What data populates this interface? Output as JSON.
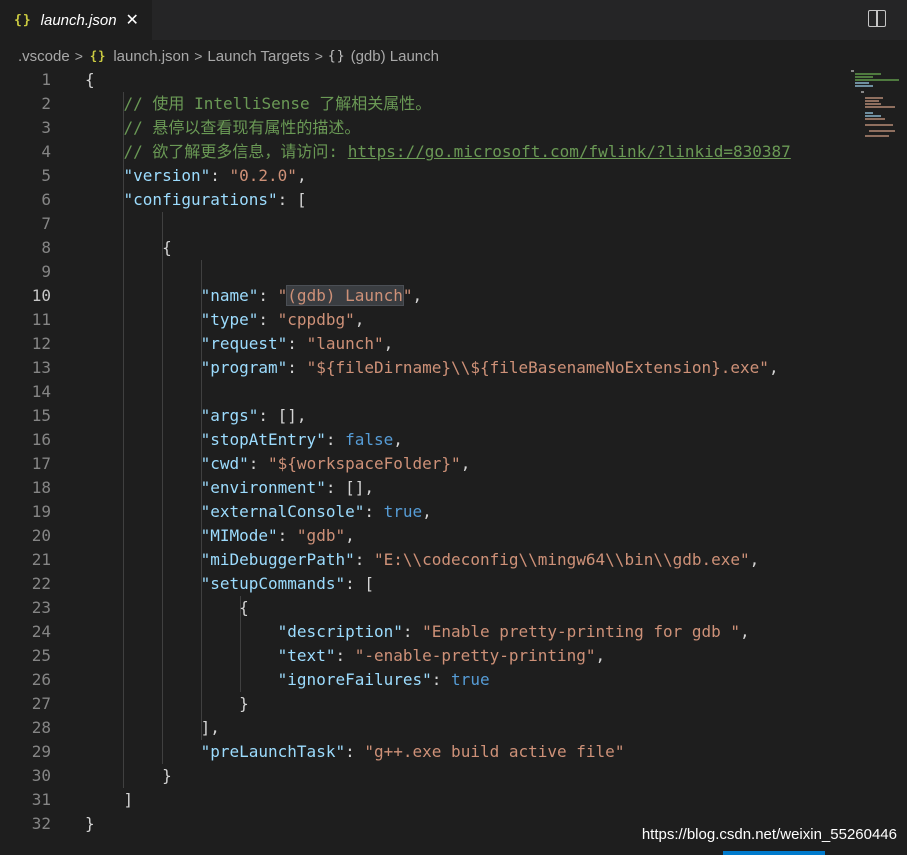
{
  "tab": {
    "icon": "{}",
    "label": "launch.json",
    "close": "✕"
  },
  "breadcrumb": {
    "folder": ".vscode",
    "file": "launch.json",
    "section": "Launch Targets",
    "item": "(gdb) Launch",
    "file_icon": "{}",
    "item_icon": "{}"
  },
  "editor": {
    "active_line": 10,
    "lines": [
      {
        "n": "1",
        "t": [
          [
            "pun",
            "{"
          ]
        ]
      },
      {
        "n": "2",
        "t": [
          [
            "com",
            "    // 使用 IntelliSense 了解相关属性。"
          ]
        ]
      },
      {
        "n": "3",
        "t": [
          [
            "com",
            "    // 悬停以查看现有属性的描述。"
          ]
        ]
      },
      {
        "n": "4",
        "t": [
          [
            "com",
            "    // 欲了解更多信息，请访问: "
          ],
          [
            "link",
            "https://go.microsoft.com/fwlink/?linkid=830387"
          ]
        ]
      },
      {
        "n": "5",
        "t": [
          [
            "pun",
            "    "
          ],
          [
            "key",
            "\"version\""
          ],
          [
            "pun",
            ": "
          ],
          [
            "str",
            "\"0.2.0\""
          ],
          [
            "pun",
            ","
          ]
        ]
      },
      {
        "n": "6",
        "t": [
          [
            "pun",
            "    "
          ],
          [
            "key",
            "\"configurations\""
          ],
          [
            "pun",
            ": ["
          ]
        ]
      },
      {
        "n": "7",
        "t": []
      },
      {
        "n": "8",
        "t": [
          [
            "pun",
            "        {"
          ]
        ]
      },
      {
        "n": "9",
        "t": []
      },
      {
        "n": "10",
        "t": [
          [
            "pun",
            "            "
          ],
          [
            "key",
            "\"name\""
          ],
          [
            "pun",
            ": "
          ],
          [
            "str",
            "\""
          ],
          [
            "strhl",
            "(gdb) Launch"
          ],
          [
            "str",
            "\""
          ],
          [
            "pun",
            ","
          ]
        ]
      },
      {
        "n": "11",
        "t": [
          [
            "pun",
            "            "
          ],
          [
            "key",
            "\"type\""
          ],
          [
            "pun",
            ": "
          ],
          [
            "str",
            "\"cppdbg\""
          ],
          [
            "pun",
            ","
          ]
        ]
      },
      {
        "n": "12",
        "t": [
          [
            "pun",
            "            "
          ],
          [
            "key",
            "\"request\""
          ],
          [
            "pun",
            ": "
          ],
          [
            "str",
            "\"launch\""
          ],
          [
            "pun",
            ","
          ]
        ]
      },
      {
        "n": "13",
        "t": [
          [
            "pun",
            "            "
          ],
          [
            "key",
            "\"program\""
          ],
          [
            "pun",
            ": "
          ],
          [
            "str",
            "\"${fileDirname}\\\\${fileBasenameNoExtension}.exe\""
          ],
          [
            "pun",
            ","
          ]
        ]
      },
      {
        "n": "14",
        "t": []
      },
      {
        "n": "15",
        "t": [
          [
            "pun",
            "            "
          ],
          [
            "key",
            "\"args\""
          ],
          [
            "pun",
            ": [],"
          ]
        ]
      },
      {
        "n": "16",
        "t": [
          [
            "pun",
            "            "
          ],
          [
            "key",
            "\"stopAtEntry\""
          ],
          [
            "pun",
            ": "
          ],
          [
            "bool",
            "false"
          ],
          [
            "pun",
            ","
          ]
        ]
      },
      {
        "n": "17",
        "t": [
          [
            "pun",
            "            "
          ],
          [
            "key",
            "\"cwd\""
          ],
          [
            "pun",
            ": "
          ],
          [
            "str",
            "\"${workspaceFolder}\""
          ],
          [
            "pun",
            ","
          ]
        ]
      },
      {
        "n": "18",
        "t": [
          [
            "pun",
            "            "
          ],
          [
            "key",
            "\"environment\""
          ],
          [
            "pun",
            ": [],"
          ]
        ]
      },
      {
        "n": "19",
        "t": [
          [
            "pun",
            "            "
          ],
          [
            "key",
            "\"externalConsole\""
          ],
          [
            "pun",
            ": "
          ],
          [
            "bool",
            "true"
          ],
          [
            "pun",
            ","
          ]
        ]
      },
      {
        "n": "20",
        "t": [
          [
            "pun",
            "            "
          ],
          [
            "key",
            "\"MIMode\""
          ],
          [
            "pun",
            ": "
          ],
          [
            "str",
            "\"gdb\""
          ],
          [
            "pun",
            ","
          ]
        ]
      },
      {
        "n": "21",
        "t": [
          [
            "pun",
            "            "
          ],
          [
            "key",
            "\"miDebuggerPath\""
          ],
          [
            "pun",
            ": "
          ],
          [
            "str",
            "\"E:\\\\codeconfig\\\\mingw64\\\\bin\\\\gdb.exe\""
          ],
          [
            "pun",
            ","
          ]
        ]
      },
      {
        "n": "22",
        "t": [
          [
            "pun",
            "            "
          ],
          [
            "key",
            "\"setupCommands\""
          ],
          [
            "pun",
            ": ["
          ]
        ]
      },
      {
        "n": "23",
        "t": [
          [
            "pun",
            "                {"
          ]
        ]
      },
      {
        "n": "24",
        "t": [
          [
            "pun",
            "                    "
          ],
          [
            "key",
            "\"description\""
          ],
          [
            "pun",
            ": "
          ],
          [
            "str",
            "\"Enable pretty-printing for gdb \""
          ],
          [
            "pun",
            ","
          ]
        ]
      },
      {
        "n": "25",
        "t": [
          [
            "pun",
            "                    "
          ],
          [
            "key",
            "\"text\""
          ],
          [
            "pun",
            ": "
          ],
          [
            "str",
            "\"-enable-pretty-printing\""
          ],
          [
            "pun",
            ","
          ]
        ]
      },
      {
        "n": "26",
        "t": [
          [
            "pun",
            "                    "
          ],
          [
            "key",
            "\"ignoreFailures\""
          ],
          [
            "pun",
            ": "
          ],
          [
            "bool",
            "true"
          ]
        ]
      },
      {
        "n": "27",
        "t": [
          [
            "pun",
            "                }"
          ]
        ]
      },
      {
        "n": "28",
        "t": [
          [
            "pun",
            "            ],"
          ]
        ]
      },
      {
        "n": "29",
        "t": [
          [
            "pun",
            "            "
          ],
          [
            "key",
            "\"preLaunchTask\""
          ],
          [
            "pun",
            ": "
          ],
          [
            "str",
            "\"g++.exe build active file\""
          ]
        ]
      },
      {
        "n": "30",
        "t": [
          [
            "pun",
            "        }"
          ]
        ]
      },
      {
        "n": "31",
        "t": [
          [
            "pun",
            "    ]"
          ]
        ]
      },
      {
        "n": "32",
        "t": [
          [
            "pun",
            "}"
          ]
        ]
      }
    ]
  },
  "watermark": "https://blog.csdn.net/weixin_55260446",
  "colors": {
    "background": "#1e1e1e",
    "comment": "#6a9955",
    "key": "#9cdcfe",
    "string": "#ce9178",
    "boolean": "#569cd6",
    "json_icon": "#cbcb41",
    "accent": "#007acc"
  }
}
